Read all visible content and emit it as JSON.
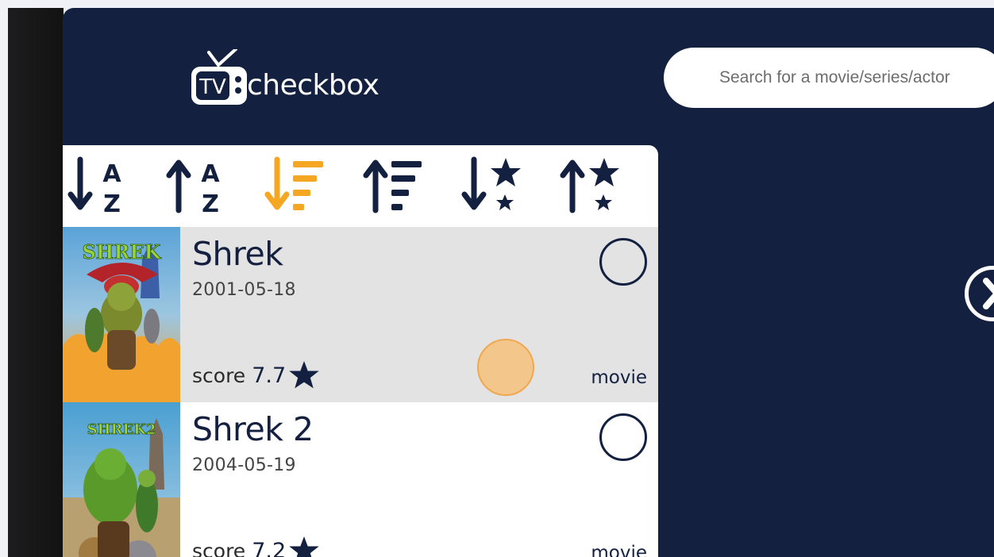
{
  "app": {
    "logo_text": "checkbox",
    "logo_badge": "TV"
  },
  "search": {
    "placeholder": "Search for a movie/series/actor"
  },
  "sort_options": [
    {
      "name": "sort-az-desc-icon",
      "active": false
    },
    {
      "name": "sort-az-asc-icon",
      "active": false
    },
    {
      "name": "sort-date-desc-icon",
      "active": true
    },
    {
      "name": "sort-date-asc-icon",
      "active": false
    },
    {
      "name": "sort-score-desc-icon",
      "active": false
    },
    {
      "name": "sort-score-asc-icon",
      "active": false
    }
  ],
  "results": [
    {
      "title": "Shrek",
      "date": "2001-05-18",
      "score_label": "score",
      "score": "7.7",
      "type": "movie",
      "checked": false
    },
    {
      "title": "Shrek 2",
      "date": "2004-05-19",
      "score_label": "score",
      "score": "7.2",
      "type": "movie",
      "checked": false
    }
  ],
  "colors": {
    "navy": "#13203f",
    "accent": "#f5a623",
    "row_highlight": "#e3e3e3"
  }
}
